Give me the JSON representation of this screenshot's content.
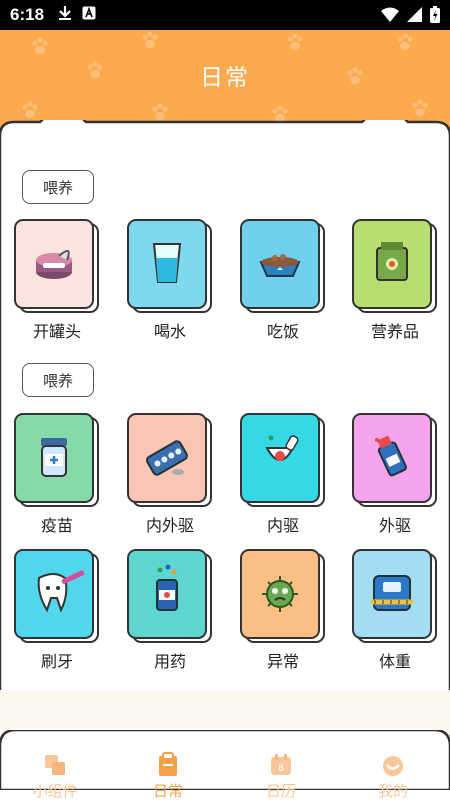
{
  "status_bar": {
    "time": "6:18"
  },
  "header": {
    "title": "日常"
  },
  "sections": [
    {
      "label": "喂养",
      "items": [
        {
          "label": "开罐头",
          "icon": "canned-food-icon",
          "color": "#FCE4E0"
        },
        {
          "label": "喝水",
          "icon": "water-glass-icon",
          "color": "#7ED8EE"
        },
        {
          "label": "吃饭",
          "icon": "food-bowl-icon",
          "color": "#6FD0EC"
        },
        {
          "label": "营养品",
          "icon": "nutrition-bag-icon",
          "color": "#B7DE6E"
        }
      ]
    },
    {
      "label": "喂养",
      "items": [
        {
          "label": "疫苗",
          "icon": "vaccine-bottle-icon",
          "color": "#86D9A8"
        },
        {
          "label": "内外驱",
          "icon": "pill-pack-icon",
          "color": "#F9C5B5"
        },
        {
          "label": "内驱",
          "icon": "medicine-jar-icon",
          "color": "#34D9E4"
        },
        {
          "label": "外驱",
          "icon": "spray-bottle-icon",
          "color": "#F3A4EC"
        },
        {
          "label": "刷牙",
          "icon": "tooth-brush-icon",
          "color": "#52D6EC"
        },
        {
          "label": "用药",
          "icon": "pill-bottle-icon",
          "color": "#5ED5D1"
        },
        {
          "label": "异常",
          "icon": "virus-icon",
          "color": "#FBBE84"
        },
        {
          "label": "体重",
          "icon": "weight-scale-icon",
          "color": "#A4DCF3"
        }
      ]
    }
  ],
  "tabs": [
    {
      "label": "小组件",
      "icon": "widget-icon",
      "active": false
    },
    {
      "label": "日常",
      "icon": "daily-icon",
      "active": true
    },
    {
      "label": "日历",
      "icon": "calendar-icon",
      "active": false
    },
    {
      "label": "我的",
      "icon": "profile-icon",
      "active": false
    }
  ],
  "colors": {
    "accent": "#FDAA4E",
    "tab_inactive": "#F9C79A",
    "tab_active": "#F4A24A"
  }
}
